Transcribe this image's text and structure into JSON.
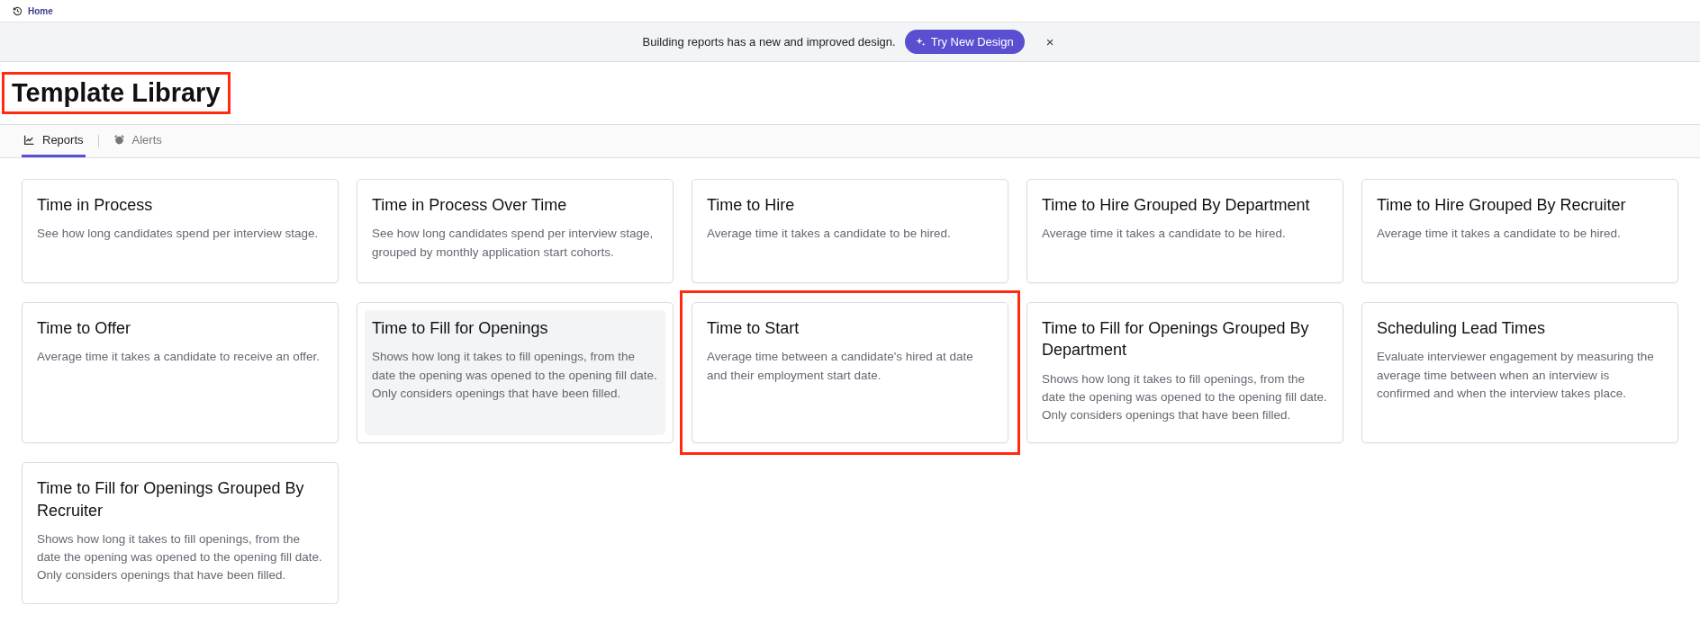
{
  "breadcrumb": {
    "label": "Home"
  },
  "banner": {
    "message": "Building reports has a new and improved design.",
    "button": "Try New Design",
    "close": "×"
  },
  "page_title": {
    "text": "Template Library",
    "highlighted": true
  },
  "tabs": [
    {
      "label": "Reports",
      "selected": true
    },
    {
      "label": "Alerts",
      "selected": false
    }
  ],
  "cards": [
    {
      "title": "Time in Process",
      "description": "See how long candidates spend per interview stage.",
      "hovered": false,
      "highlighted": false
    },
    {
      "title": "Time in Process Over Time",
      "description": "See how long candidates spend per interview stage, grouped by monthly application start cohorts.",
      "hovered": false,
      "highlighted": false
    },
    {
      "title": "Time to Hire",
      "description": "Average time it takes a candidate to be hired.",
      "hovered": false,
      "highlighted": false
    },
    {
      "title": "Time to Hire Grouped By Department",
      "description": "Average time it takes a candidate to be hired.",
      "hovered": false,
      "highlighted": false
    },
    {
      "title": "Time to Hire Grouped By Recruiter",
      "description": "Average time it takes a candidate to be hired.",
      "hovered": false,
      "highlighted": false
    },
    {
      "title": "Time to Offer",
      "description": "Average time it takes a candidate to receive an offer.",
      "hovered": false,
      "highlighted": false
    },
    {
      "title": "Time to Fill for Openings",
      "description": "Shows how long it takes to fill openings, from the date the opening was opened to the opening fill date. Only considers openings that have been filled.",
      "hovered": true,
      "highlighted": false
    },
    {
      "title": "Time to Start",
      "description": "Average time between a candidate's hired at date and their employment start date.",
      "hovered": false,
      "highlighted": true
    },
    {
      "title": "Time to Fill for Openings Grouped By Department",
      "description": "Shows how long it takes to fill openings, from the date the opening was opened to the opening fill date. Only considers openings that have been filled.",
      "hovered": false,
      "highlighted": false
    },
    {
      "title": "Scheduling Lead Times",
      "description": "Evaluate interviewer engagement by measuring the average time between when an interview is confirmed and when the interview takes place.",
      "hovered": false,
      "highlighted": false
    },
    {
      "title": "Time to Fill for Openings Grouped By Recruiter",
      "description": "Shows how long it takes to fill openings, from the date the opening was opened to the opening fill date. Only considers openings that have been filled.",
      "hovered": false,
      "highlighted": false
    }
  ]
}
